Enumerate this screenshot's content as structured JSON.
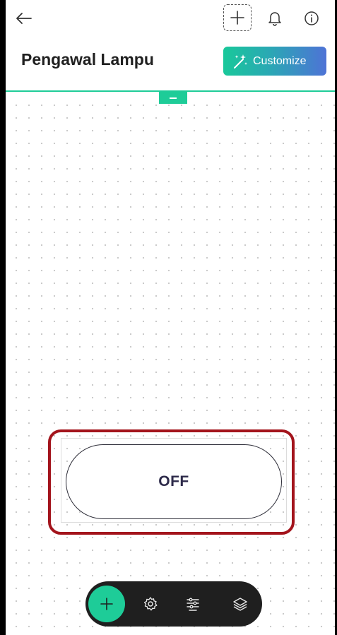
{
  "header": {
    "title": "Pengawal Lampu",
    "customize_label": "Customize",
    "icons": [
      "arrow-left-icon",
      "plus-icon",
      "bell-icon",
      "info-icon"
    ]
  },
  "widget": {
    "type": "switch",
    "label": "OFF",
    "state": "off"
  },
  "toolbar": {
    "icons": [
      "plus-icon",
      "gear-icon",
      "list-sliders-icon",
      "layers-icon"
    ]
  },
  "colors": {
    "accent": "#1ecc98",
    "highlight": "#a3141c",
    "toolbar_bg": "#1f1f1f",
    "customize_gradient": [
      "#19c89a",
      "#4e73d6"
    ]
  }
}
